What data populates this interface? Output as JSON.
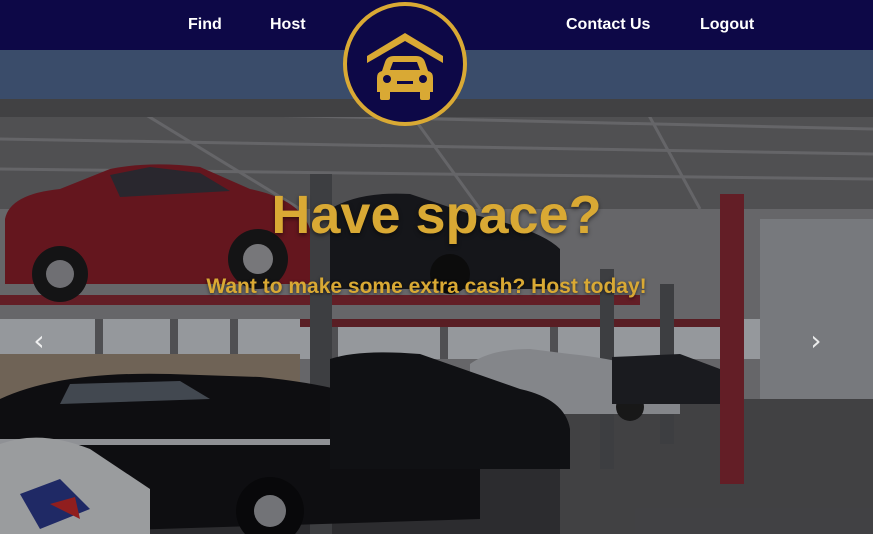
{
  "nav": {
    "left": [
      {
        "label": "Find"
      },
      {
        "label": "Host"
      }
    ],
    "right": [
      {
        "label": "Contact Us"
      },
      {
        "label": "Logout"
      }
    ],
    "logo_icon": "garage-car-icon"
  },
  "hero": {
    "title": "Have space?",
    "subtitle": "Want to make some extra cash? Host today!",
    "prev_icon": "chevron-left-icon",
    "next_icon": "chevron-right-icon",
    "prev_glyph": "‹",
    "next_glyph": "›"
  },
  "colors": {
    "nav_bg": "#0d0847",
    "subbar_bg": "#3a4c6a",
    "accent": "#d9a934",
    "nav_text": "#ffffff"
  }
}
